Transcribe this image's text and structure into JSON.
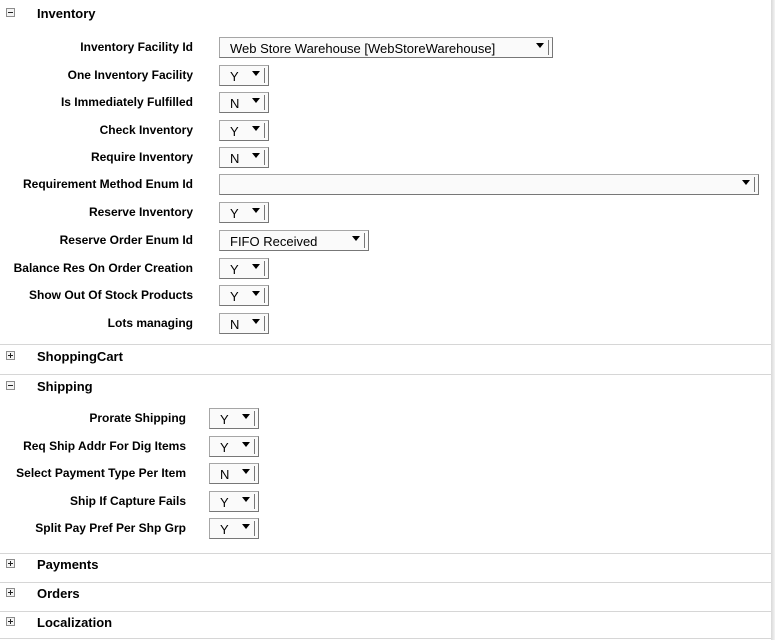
{
  "sections": {
    "inventory": {
      "title": "Inventory",
      "expanded": true
    },
    "shopping_cart": {
      "title": "ShoppingCart",
      "expanded": false
    },
    "shipping": {
      "title": "Shipping",
      "expanded": true
    },
    "payments": {
      "title": "Payments",
      "expanded": false
    },
    "orders": {
      "title": "Orders",
      "expanded": false
    },
    "localization": {
      "title": "Localization",
      "expanded": false
    }
  },
  "inventory_fields": [
    {
      "label": "Inventory Facility Id",
      "value": "Web Store Warehouse [WebStoreWarehouse]"
    },
    {
      "label": "One Inventory Facility",
      "value": "Y"
    },
    {
      "label": "Is Immediately Fulfilled",
      "value": "N"
    },
    {
      "label": "Check Inventory",
      "value": "Y"
    },
    {
      "label": "Require Inventory",
      "value": "N"
    },
    {
      "label": "Requirement Method Enum Id",
      "value": ""
    },
    {
      "label": "Reserve Inventory",
      "value": "Y"
    },
    {
      "label": "Reserve Order Enum Id",
      "value": "FIFO Received"
    },
    {
      "label": "Balance Res On Order Creation",
      "value": "Y"
    },
    {
      "label": "Show Out Of Stock Products",
      "value": "Y"
    },
    {
      "label": "Lots managing",
      "value": "N"
    }
  ],
  "shipping_fields": [
    {
      "label": "Prorate Shipping",
      "value": "Y"
    },
    {
      "label": "Req Ship Addr For Dig Items",
      "value": "Y"
    },
    {
      "label": "Select Payment Type Per Item",
      "value": "N"
    },
    {
      "label": "Ship If Capture Fails",
      "value": "Y"
    },
    {
      "label": "Split Pay Pref Per Shp Grp",
      "value": "Y"
    }
  ],
  "icons": {
    "collapse": "minus-icon",
    "expand": "plus-icon",
    "dropdown": "chevron-down-icon"
  }
}
